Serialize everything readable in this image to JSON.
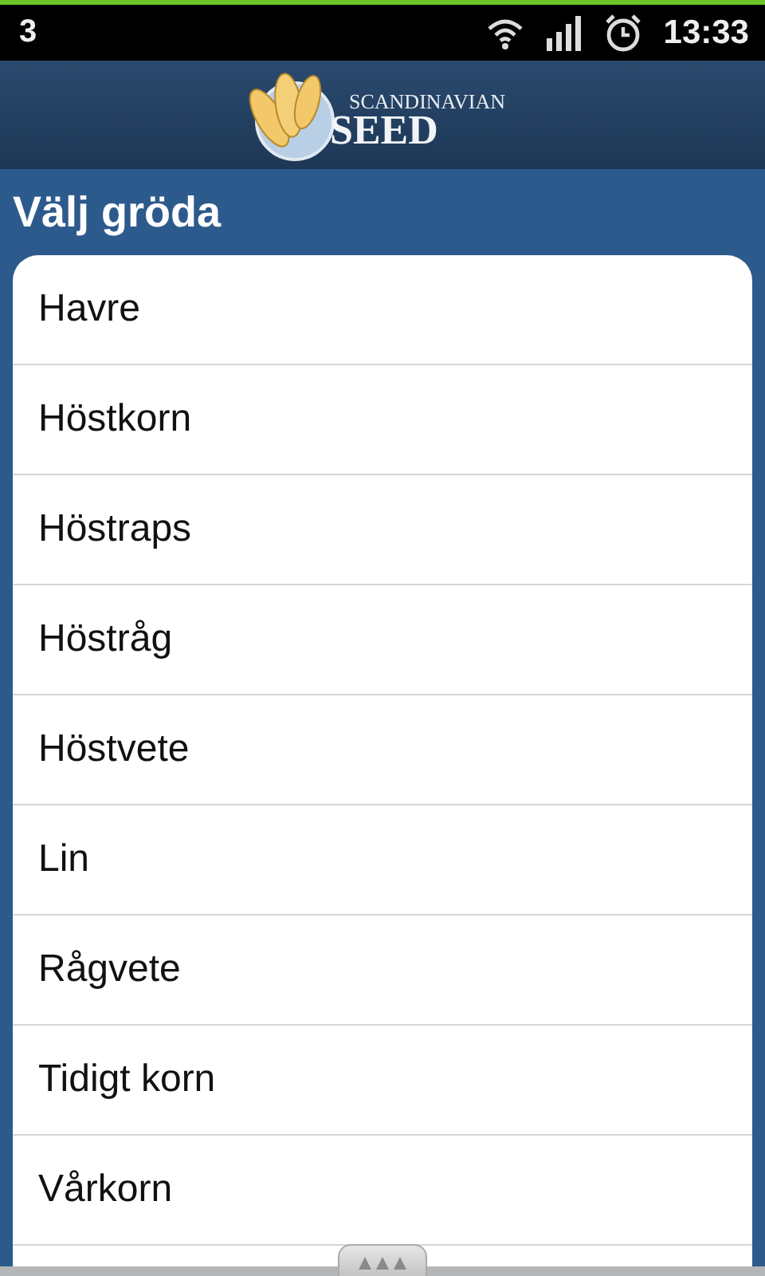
{
  "status_bar": {
    "notification": "3",
    "time": "13:33"
  },
  "header": {
    "logo_small": "SCANDINAVIAN",
    "logo_large": "SEED"
  },
  "title": "Välj gröda",
  "items": [
    {
      "label": "Havre"
    },
    {
      "label": "Höstkorn"
    },
    {
      "label": "Höstraps"
    },
    {
      "label": "Höstråg"
    },
    {
      "label": "Höstvete"
    },
    {
      "label": "Lin"
    },
    {
      "label": "Rågvete"
    },
    {
      "label": "Tidigt korn"
    },
    {
      "label": "Vårkorn"
    }
  ]
}
